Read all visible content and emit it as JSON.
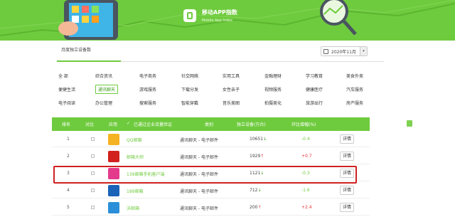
{
  "banner": {
    "title": "移动APP指数",
    "subtitle": "Mobile App Index"
  },
  "tabs": {
    "active": "月度独立设备数"
  },
  "month_picker": {
    "value": "2020年11月"
  },
  "categories": [
    [
      "全 部",
      "综合资讯",
      "电子商务",
      "社交网络",
      "实用工具",
      "金融理财",
      "学习教育",
      "美食外卖"
    ],
    [
      "便捷生活",
      "通讯聊天",
      "游戏服务",
      "下载分发",
      "女性亲子",
      "视频服务",
      "健康医疗",
      "汽车服务"
    ],
    [
      "电子阅读",
      "办公管理",
      "搜索服务",
      "智能穿戴",
      "音乐美图",
      "拍摄美化",
      "旅游出行",
      "房产服务"
    ]
  ],
  "active_category": "通讯聊天",
  "table": {
    "headers": {
      "rank": "排名",
      "compare": "对比",
      "app": "应用",
      "verified": "已通过企业流量验证",
      "category": "类别",
      "devices": "独立设备(万台)",
      "growth": "环比增幅(%)"
    },
    "rows": [
      {
        "rank": "1",
        "name": "QQ邮箱",
        "category": "通讯聊天 - 电子邮件",
        "devices": "10651",
        "trend": "down",
        "growth": "-0.4",
        "detail": "详情",
        "icon_color": "#f5b324"
      },
      {
        "rank": "2",
        "name": "邮箱大师",
        "category": "通讯聊天 - 电子邮件",
        "devices": "1929",
        "trend": "up",
        "growth": "+0.7",
        "detail": "详情",
        "icon_color": "#d2201e"
      },
      {
        "rank": "3",
        "name": "139邮箱手机客户端",
        "category": "通讯聊天 - 电子邮件",
        "devices": "1121",
        "trend": "down",
        "growth": "-0.3",
        "detail": "详情",
        "icon_color": "#e33a8c"
      },
      {
        "rank": "4",
        "name": "189邮箱",
        "category": "通讯聊天 - 电子邮件",
        "devices": "712",
        "trend": "down",
        "growth": "-1.6",
        "detail": "详情",
        "icon_color": "#1a63b8"
      },
      {
        "rank": "5",
        "name": "沃邮箱",
        "category": "通讯聊天 - 电子邮件",
        "devices": "200",
        "trend": "up",
        "growth": "+2.4",
        "detail": "详情",
        "icon_color": "#2a8fd8"
      }
    ]
  }
}
